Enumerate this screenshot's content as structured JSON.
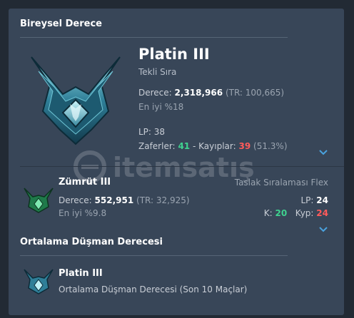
{
  "solo": {
    "header": "Bireysel Derece",
    "tier": "Platin III",
    "queue": "Tekli Sıra",
    "rank_label": "Derece:",
    "rank_value": "2,318,966",
    "rank_tr": "(TR: 100,665)",
    "top": "En iyi %18",
    "lp": "LP: 38",
    "wins_label": "Zaferler:",
    "wins": "41",
    "dash": "-",
    "losses_label": "Kayıplar:",
    "losses": "39",
    "ratio": "(51.3%)"
  },
  "flex": {
    "tier": "Zümrüt III",
    "queue": "Taslak Sıralaması Flex",
    "rank_label": "Derece:",
    "rank_value": "552,951",
    "rank_tr": "(TR: 32,925)",
    "top": "En iyi %9.8",
    "lp_label": "LP:",
    "lp_value": "24",
    "k_label": "K:",
    "k_value": "20",
    "kyp_label": "Kyp:",
    "kyp_value": "24"
  },
  "enemy": {
    "header": "Ortalama Düşman Derecesi",
    "tier": "Platin III",
    "desc": "Ortalama Düşman Derecesi (Son 10 Maçlar)"
  },
  "watermark": "itemsatış",
  "colors": {
    "accent": "#3fd28f",
    "loss": "#ff5b5b",
    "chevron": "#4aa3df",
    "card": "#384658"
  }
}
